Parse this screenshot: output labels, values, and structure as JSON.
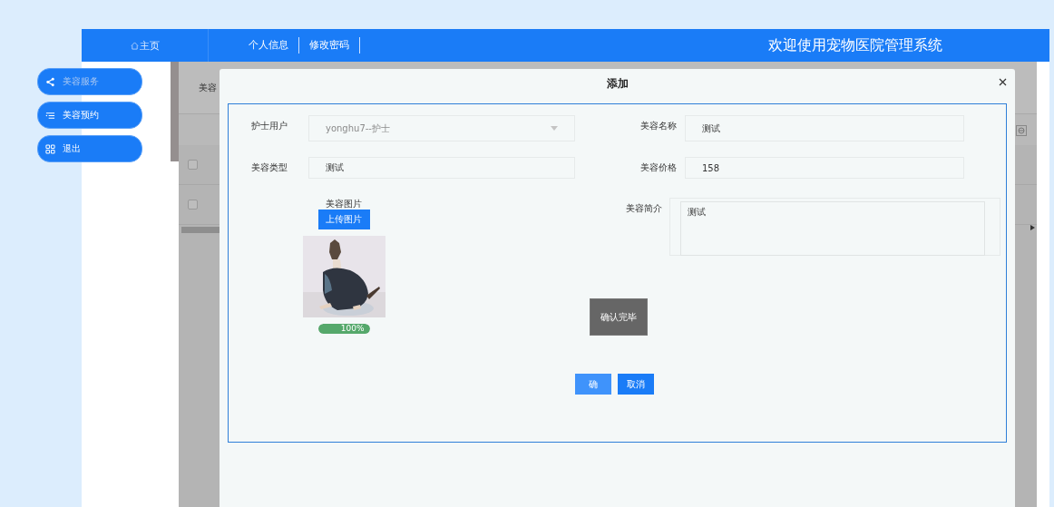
{
  "header": {
    "home": "主页",
    "nav": [
      "个人信息",
      "修改密码"
    ],
    "title": "欢迎使用宠物医院管理系统"
  },
  "sidebar": [
    {
      "label": "美容服务",
      "kind": "share",
      "selected": true
    },
    {
      "label": "美容预约",
      "kind": "list",
      "selected": false
    },
    {
      "label": "退出",
      "kind": "grid",
      "selected": false
    }
  ],
  "background": {
    "column_1": "美容",
    "rows": [
      {
        "checked": false
      },
      {
        "checked": false
      }
    ]
  },
  "dialog": {
    "title": "添加",
    "fields": [
      {
        "label": "护士用户",
        "value": "yonghu7--护士",
        "kind": "select",
        "disabled": true
      },
      {
        "label": "美容名称",
        "value": "测试",
        "kind": "text",
        "disabled": false
      },
      {
        "label": "美容类型",
        "value": "测试",
        "kind": "text",
        "disabled": false
      },
      {
        "label": "美容价格",
        "value": "158",
        "kind": "text",
        "disabled": false
      }
    ],
    "image_label": "美容图片",
    "upload_button": "上传图片",
    "upload_progress": {
      "level": 1,
      "reading": "100%"
    },
    "description": {
      "label": "美容简介",
      "value": "测试"
    },
    "confirm_done": "确认完毕",
    "buttons": [
      {
        "label": "确",
        "hovered": true
      },
      {
        "label": "取消",
        "hovered": false
      }
    ]
  }
}
